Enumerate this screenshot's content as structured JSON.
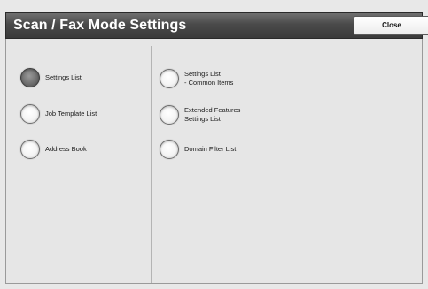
{
  "header": {
    "title": "Scan / Fax Mode Settings",
    "close_label": "Close"
  },
  "left_options": [
    {
      "label": "Settings List",
      "selected": true
    },
    {
      "label": "Job Template List",
      "selected": false
    },
    {
      "label": "Address Book",
      "selected": false
    }
  ],
  "right_options": [
    {
      "label": "Settings List\n- Common Items",
      "selected": false
    },
    {
      "label": "Extended Features\nSettings List",
      "selected": false
    },
    {
      "label": "Domain Filter List",
      "selected": false
    }
  ],
  "colors": {
    "title_bar": "#4a4a4a",
    "panel": "#e6e6e6",
    "selected_radio": "#6e6e6e"
  }
}
